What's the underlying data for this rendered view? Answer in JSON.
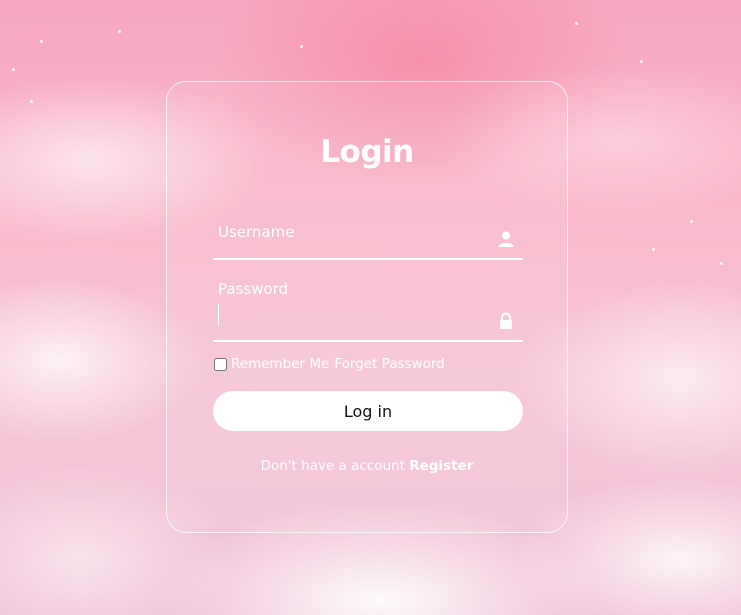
{
  "login_form": {
    "title": "Login",
    "username": {
      "label": "Username",
      "value": ""
    },
    "password": {
      "label": "Password",
      "value": ""
    },
    "remember_me_label": "Remember Me",
    "forgot_password_label": "Forget Password",
    "login_button_label": "Log in",
    "no_account_text": "Don't have a account",
    "register_link_label": "Register"
  },
  "icons": {
    "username": "user-icon",
    "password": "lock-icon"
  },
  "colors": {
    "background_pink": "#f8b9cb",
    "text": "#ffffff",
    "button_background": "#ffffff",
    "button_text": "#111111"
  }
}
